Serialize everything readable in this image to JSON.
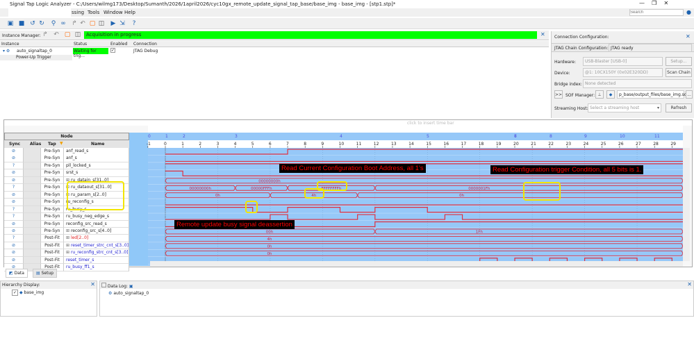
{
  "window": {
    "title": "Signal Tap Logic Analyzer - C:/Users/wilmg173/Desktop/Sumanth/2026/1april2026/cyc10gx_remote_update_signal_tap_base/base_img - base_img - [stp1.stp]*",
    "search_placeholder": "Search"
  },
  "menu": [
    "ssing",
    "Tools",
    "Window",
    "Help"
  ],
  "instance_manager": {
    "label": "Instance Manager:",
    "status": "Acquisition in progress",
    "columns": [
      "Instance",
      "Status",
      "Enabled",
      "Connection"
    ],
    "rows": [
      {
        "instance": "auto_signaltap_0",
        "status": "Waiting for trig...",
        "enabled": "✓",
        "connection": "JTAG Debug"
      }
    ],
    "sub": "Power-Up Trigger"
  },
  "connection": {
    "title": "Connection Configuration:",
    "jtag_label": "JTAG Chain Configuration:",
    "jtag_status": "JTAG ready",
    "hardware_label": "Hardware:",
    "hardware": "USB-Blaster [USB-0]",
    "setup": "Setup...",
    "device_label": "Device:",
    "device": "@1: 10CX150Y (0x02E320DD)",
    "scan": "Scan Chain",
    "bridge_label": "Bridge index:",
    "bridge": "None detected",
    "expand": ">>",
    "sof_label": "SOF Manager:",
    "sof": "p_base/output_files/base_img.sof",
    "more": "...",
    "stream_label": "Streaming Host:",
    "stream": "Select a streaming host",
    "refresh": "Refresh"
  },
  "waveform": {
    "timebar_hint": "click to insert time bar",
    "node_header": "Node",
    "columns": [
      "Sync",
      "Alias",
      "Tap",
      "Name"
    ],
    "top_ticks": [
      "0",
      "1",
      "2",
      "3",
      "4",
      "5",
      "6",
      "7",
      "8",
      "9",
      "10",
      "11"
    ],
    "sample_start": -1,
    "sample_end": 29,
    "signals": [
      {
        "tap": "Pre-Syn",
        "name": "anf_read_s",
        "type": "bit",
        "init": 0,
        "edges": [
          7
        ],
        "sync": "ok"
      },
      {
        "tap": "Pre-Syn",
        "name": "anf_s",
        "type": "bit",
        "init": 0,
        "edges": [],
        "sync": "ok"
      },
      {
        "tap": "Pre-Syn",
        "name": "pll_locked_s",
        "type": "bit",
        "init": 1,
        "edges": [],
        "sync": "?"
      },
      {
        "tap": "Pre-Syn",
        "name": "srst_s",
        "type": "bit",
        "init": 1,
        "edges": [
          1
        ],
        "sync": "ok"
      },
      {
        "tap": "Pre-Syn",
        "name": "ru_datain_s[31..0]",
        "type": "bus",
        "bus": true,
        "segs": [
          [
            0,
            "00000000h"
          ]
        ],
        "sync": "ok"
      },
      {
        "tap": "Pre-Syn",
        "name": "ru_dataout_s[31..0]",
        "type": "bus",
        "bus": true,
        "segs": [
          [
            0,
            "00000000h"
          ],
          [
            4,
            "00000FFFh"
          ],
          [
            7,
            "FFFFFFFFh"
          ],
          [
            12,
            "0000001Fh"
          ]
        ],
        "sync": "?"
      },
      {
        "tap": "Pre-Syn",
        "name": "ru_param_s[2..0]",
        "type": "bus",
        "bus": true,
        "segs": [
          [
            0,
            "0h"
          ],
          [
            6,
            "4h"
          ],
          [
            11,
            "0h"
          ]
        ],
        "sync": "ok"
      },
      {
        "tap": "Pre-Syn",
        "name": "ru_reconfig_s",
        "type": "bit",
        "init": 0,
        "edges": [],
        "sync": "ok"
      },
      {
        "tap": "Pre-Syn",
        "name": "ru_busy_s",
        "type": "bit",
        "init": 1,
        "edges": [
          5,
          7,
          10,
          12,
          15
        ],
        "sync": "?"
      },
      {
        "tap": "Pre-Syn",
        "name": "ru_busy_neg_edge_s",
        "type": "bit",
        "init": 0,
        "edges": [
          6,
          7,
          11,
          12,
          16,
          17
        ],
        "sync": "?"
      },
      {
        "tap": "Pre-Syn",
        "name": "reconfig_src_read_s",
        "type": "bit",
        "init": 0,
        "edges": [
          12
        ],
        "sync": "ok"
      },
      {
        "tap": "Pre-Syn",
        "name": "reconfig_src_s[4..0]",
        "type": "bus",
        "bus": true,
        "segs": [
          [
            0,
            "00h"
          ],
          [
            12,
            "1Fh"
          ]
        ],
        "sync": "ok"
      },
      {
        "tap": "Post-Fit",
        "name": "led[2..0]",
        "type": "bus",
        "bus": true,
        "red": true,
        "segs": [
          [
            0,
            "4h"
          ]
        ],
        "sync": "?"
      },
      {
        "tap": "Post-Fit",
        "name": "reset_timer_strc_cnt_s[3..0]",
        "type": "bus",
        "bus": true,
        "blue": true,
        "segs": [
          [
            0,
            "0h"
          ]
        ],
        "sync": "ok"
      },
      {
        "tap": "Post-Fit",
        "name": "ru_reconfig_strc_cnt_s[3..0]",
        "type": "bus",
        "bus": true,
        "blue": true,
        "segs": [
          [
            0,
            "0h"
          ]
        ],
        "sync": "ok"
      },
      {
        "tap": "Post-Fit",
        "name": "reset_timer_s",
        "type": "bit",
        "blue": true,
        "init": 0,
        "edges": [
          18,
          19,
          20,
          21,
          22,
          23,
          24,
          25,
          26,
          27,
          28,
          29
        ],
        "sync": "ok"
      },
      {
        "tap": "Post-Fit",
        "name": "ru_busy_ff1_s",
        "type": "bit",
        "blue": true,
        "init": 0,
        "edges": [],
        "sync": "ok"
      }
    ],
    "annotations": [
      "Read Current Configuration Boot Address, all 1's",
      "Read Configuration trigger Condition, all 5 bits is 1.",
      "Remote update busy signal deassertion"
    ]
  },
  "tabs": [
    "Data",
    "Setup"
  ],
  "hierarchy": {
    "title": "Hierarchy Display:",
    "item": "base_img"
  },
  "datalog": {
    "title": "Data Log:",
    "item": "auto_signaltap_0"
  }
}
